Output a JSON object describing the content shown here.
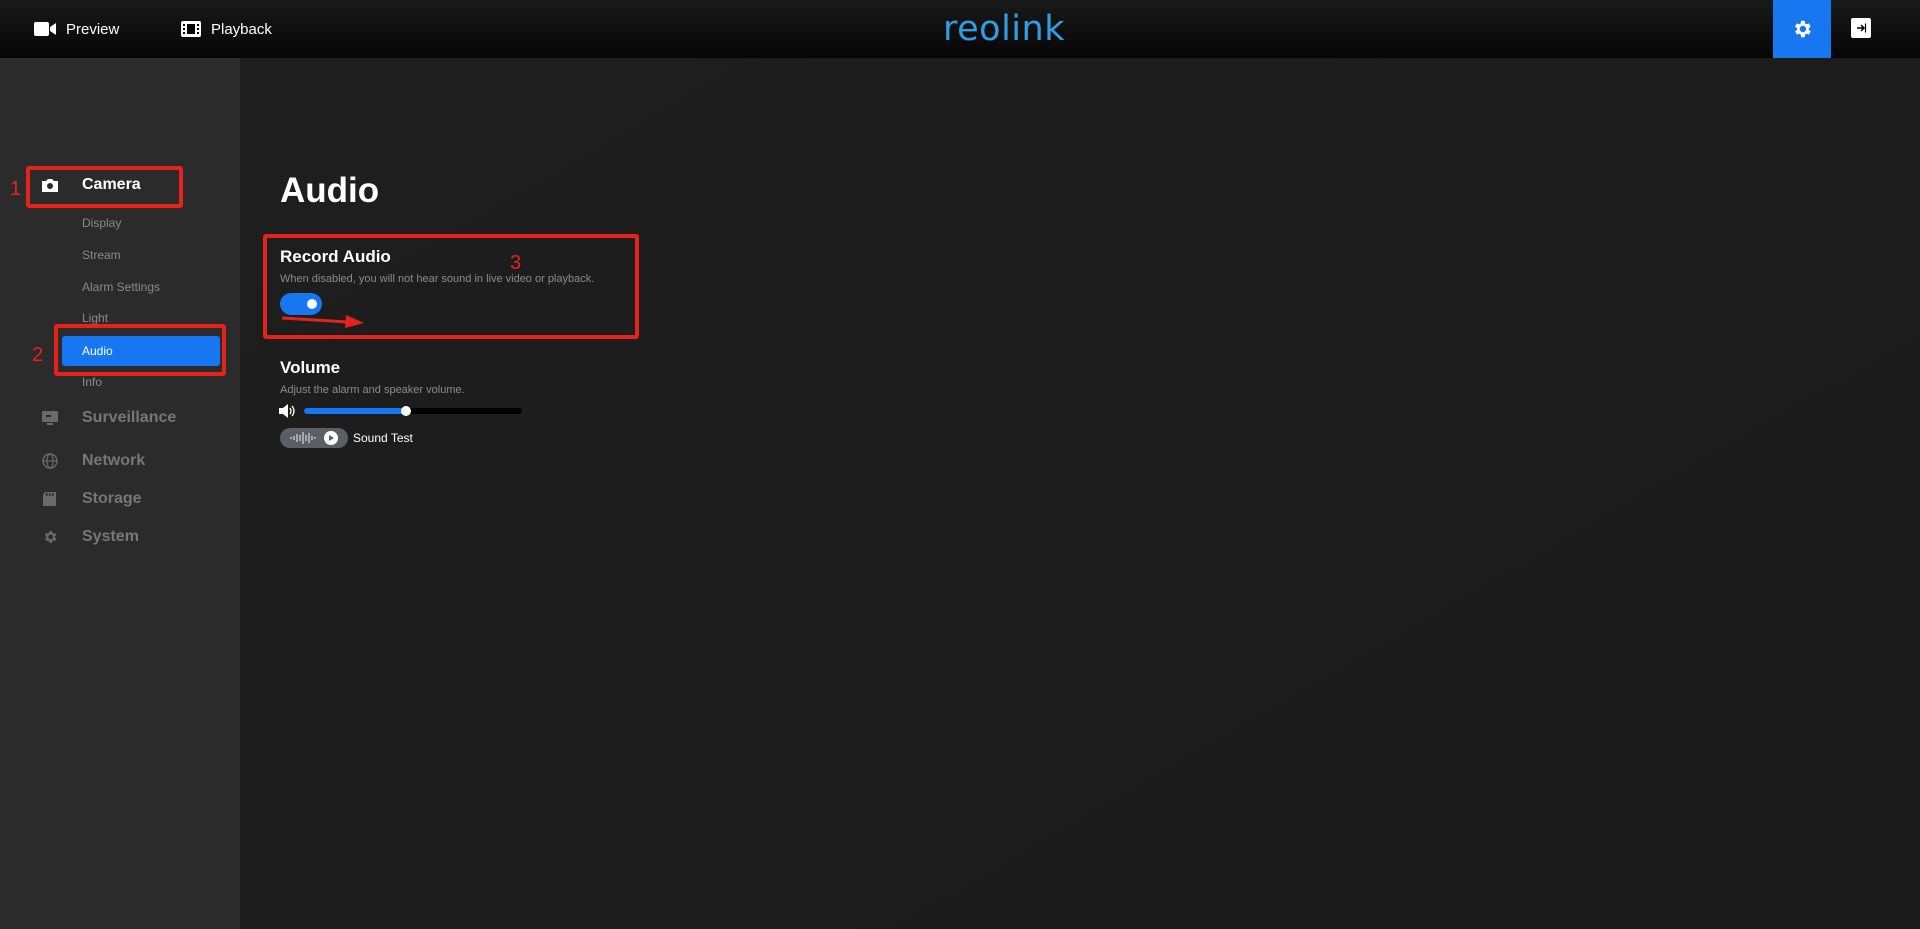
{
  "topbar": {
    "preview_label": "Preview",
    "playback_label": "Playback",
    "logo_text": "reolink",
    "settings_icon": "gear-icon",
    "logout_icon": "logout-icon",
    "accent_color": "#1677f0"
  },
  "sidebar": {
    "sections": [
      {
        "label": "Camera",
        "icon": "camera-icon",
        "active": true
      },
      {
        "label": "Surveillance",
        "icon": "monitor-icon",
        "active": false
      },
      {
        "label": "Network",
        "icon": "globe-icon",
        "active": false
      },
      {
        "label": "Storage",
        "icon": "storage-icon",
        "active": false
      },
      {
        "label": "System",
        "icon": "gear-icon",
        "active": false
      }
    ],
    "camera_items": [
      {
        "label": "Display"
      },
      {
        "label": "Stream"
      },
      {
        "label": "Alarm Settings"
      },
      {
        "label": "Light"
      },
      {
        "label": "Audio",
        "active": true
      },
      {
        "label": "Info"
      }
    ]
  },
  "main": {
    "title": "Audio",
    "record_audio": {
      "title": "Record Audio",
      "description": "When disabled, you will not hear sound in live video or playback.",
      "enabled": true
    },
    "volume": {
      "title": "Volume",
      "description": "Adjust the alarm and speaker volume.",
      "level_percent": 47,
      "sound_test_label": "Sound Test"
    }
  },
  "annotations": {
    "numbers": [
      "1",
      "2",
      "3"
    ],
    "color": "#e6231a"
  }
}
